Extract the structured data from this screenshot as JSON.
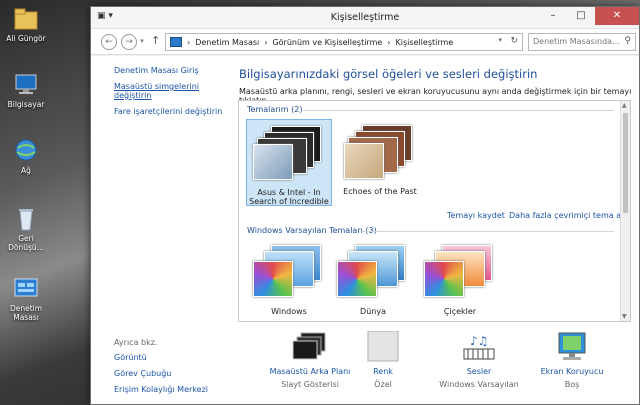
{
  "desktop": {
    "icons": [
      {
        "label": "Ali Güngör"
      },
      {
        "label": "Bilgisayar"
      },
      {
        "label": "Ağ"
      },
      {
        "label": "Geri Dönüşü..."
      },
      {
        "label": "Denetim Masası"
      }
    ]
  },
  "window": {
    "title": "Kişiselleştirme",
    "controls": {
      "minimize": "–",
      "maximize": "□",
      "close": "✕"
    }
  },
  "navbar": {
    "breadcrumb": [
      "Denetim Masası",
      "Görünüm ve Kişiselleştirme",
      "Kişiselleştirme"
    ],
    "search_placeholder": "Denetim Masasında..."
  },
  "sidebar": {
    "items": [
      {
        "label": "Denetim Masası Giriş"
      },
      {
        "label": "Masaüstü simgelerini değiştirin"
      },
      {
        "label": "Fare işaretçilerini değiştirin"
      }
    ],
    "see_also_header": "Ayrıca bkz.",
    "see_also": [
      {
        "label": "Görüntü"
      },
      {
        "label": "Görev Çubuğu"
      },
      {
        "label": "Erişim Kolaylığı Merkezi"
      }
    ]
  },
  "main": {
    "heading": "Bilgisayarınızdaki görsel öğeleri ve sesleri değiştirin",
    "description": "Masaüstü arka planını, rengi, sesleri ve ekran koruyucusunu aynı anda değiştirmek için bir temayı tıklatın.",
    "my_themes_header": "Temalarım (2)",
    "my_themes": [
      {
        "label": "Asus & Intel - In Search of Incredible"
      },
      {
        "label": "Echoes of the Past"
      }
    ],
    "save_theme": "Temayı kaydet",
    "more_themes": "Daha fazla çevrimiçi tema al",
    "default_themes_header": "Windows Varsayılan Temaları (3)",
    "default_themes": [
      {
        "label": "Windows"
      },
      {
        "label": "Dünya"
      },
      {
        "label": "Çiçekler"
      }
    ]
  },
  "bottom": {
    "items": [
      {
        "label": "Masaüstü Arka Planı",
        "sub": "Slayt Gösterisi"
      },
      {
        "label": "Renk",
        "sub": "Özel"
      },
      {
        "label": "Sesler",
        "sub": "Windows Varsayılan"
      },
      {
        "label": "Ekran Koruyucu",
        "sub": "Boş"
      }
    ]
  }
}
